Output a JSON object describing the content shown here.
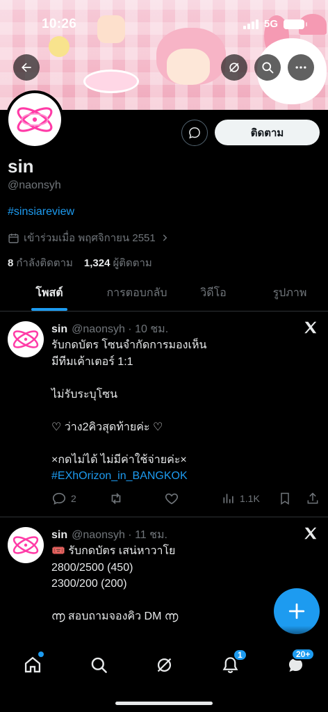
{
  "status_bar": {
    "time": "10:26",
    "network": "5G"
  },
  "banner": {
    "description_colors": {
      "background": "#f6cbd8"
    }
  },
  "nav_icons": {
    "back": "arrow-left-icon",
    "grok": "grok-icon",
    "search": "search-icon",
    "more": "more-icon"
  },
  "profile": {
    "display_name": "sin",
    "handle": "@naonsyh",
    "bio_link": "#sinsiareview",
    "joined": "เข้าร่วมเมื่อ พฤศจิกายน 2551",
    "following_count": "8",
    "following_label": "กำลังติดตาม",
    "followers_count": "1,324",
    "followers_label": "ผู้ติดตาม",
    "follow_button": "ติดตาม"
  },
  "tabs": [
    {
      "label": "โพสต์",
      "active": true
    },
    {
      "label": "การตอบกลับ",
      "active": false
    },
    {
      "label": "วิดีโอ",
      "active": false
    },
    {
      "label": "รูปภาพ",
      "active": false
    }
  ],
  "posts": [
    {
      "name": "sin",
      "meta": "@naonsyh · 10 ชม.",
      "lines": "รับกดบัตร โซนจำกัดการมองเห็น\nมีทีมเค้าเตอร์ 1:1\n\nไม่รับระบุโซน\n\n♡ ว่าง2คิวสุดท้ายค่ะ ♡\n\n×กดไม่ได้ ไม่มีค่าใช้จ่ายค่ะ×",
      "hashtag": "#EXhOrizon_in_BANGKOK",
      "replies": "2",
      "views": "1.1K"
    },
    {
      "name": "sin",
      "meta": "@naonsyh · 11 ชม.",
      "lines": "🎟️ รับกดบัตร เสน่หาวาโย\n2800/2500 (450)\n2300/200 (200)\n\n൬ สอบถามจองคิว DM ൬"
    }
  ],
  "bottom_nav": {
    "notifications_badge": "1",
    "messages_badge": "20+"
  },
  "colors": {
    "accent": "#1d9bf0",
    "text": "#e7e9ea",
    "muted": "#71767b",
    "border": "#2f3336"
  }
}
